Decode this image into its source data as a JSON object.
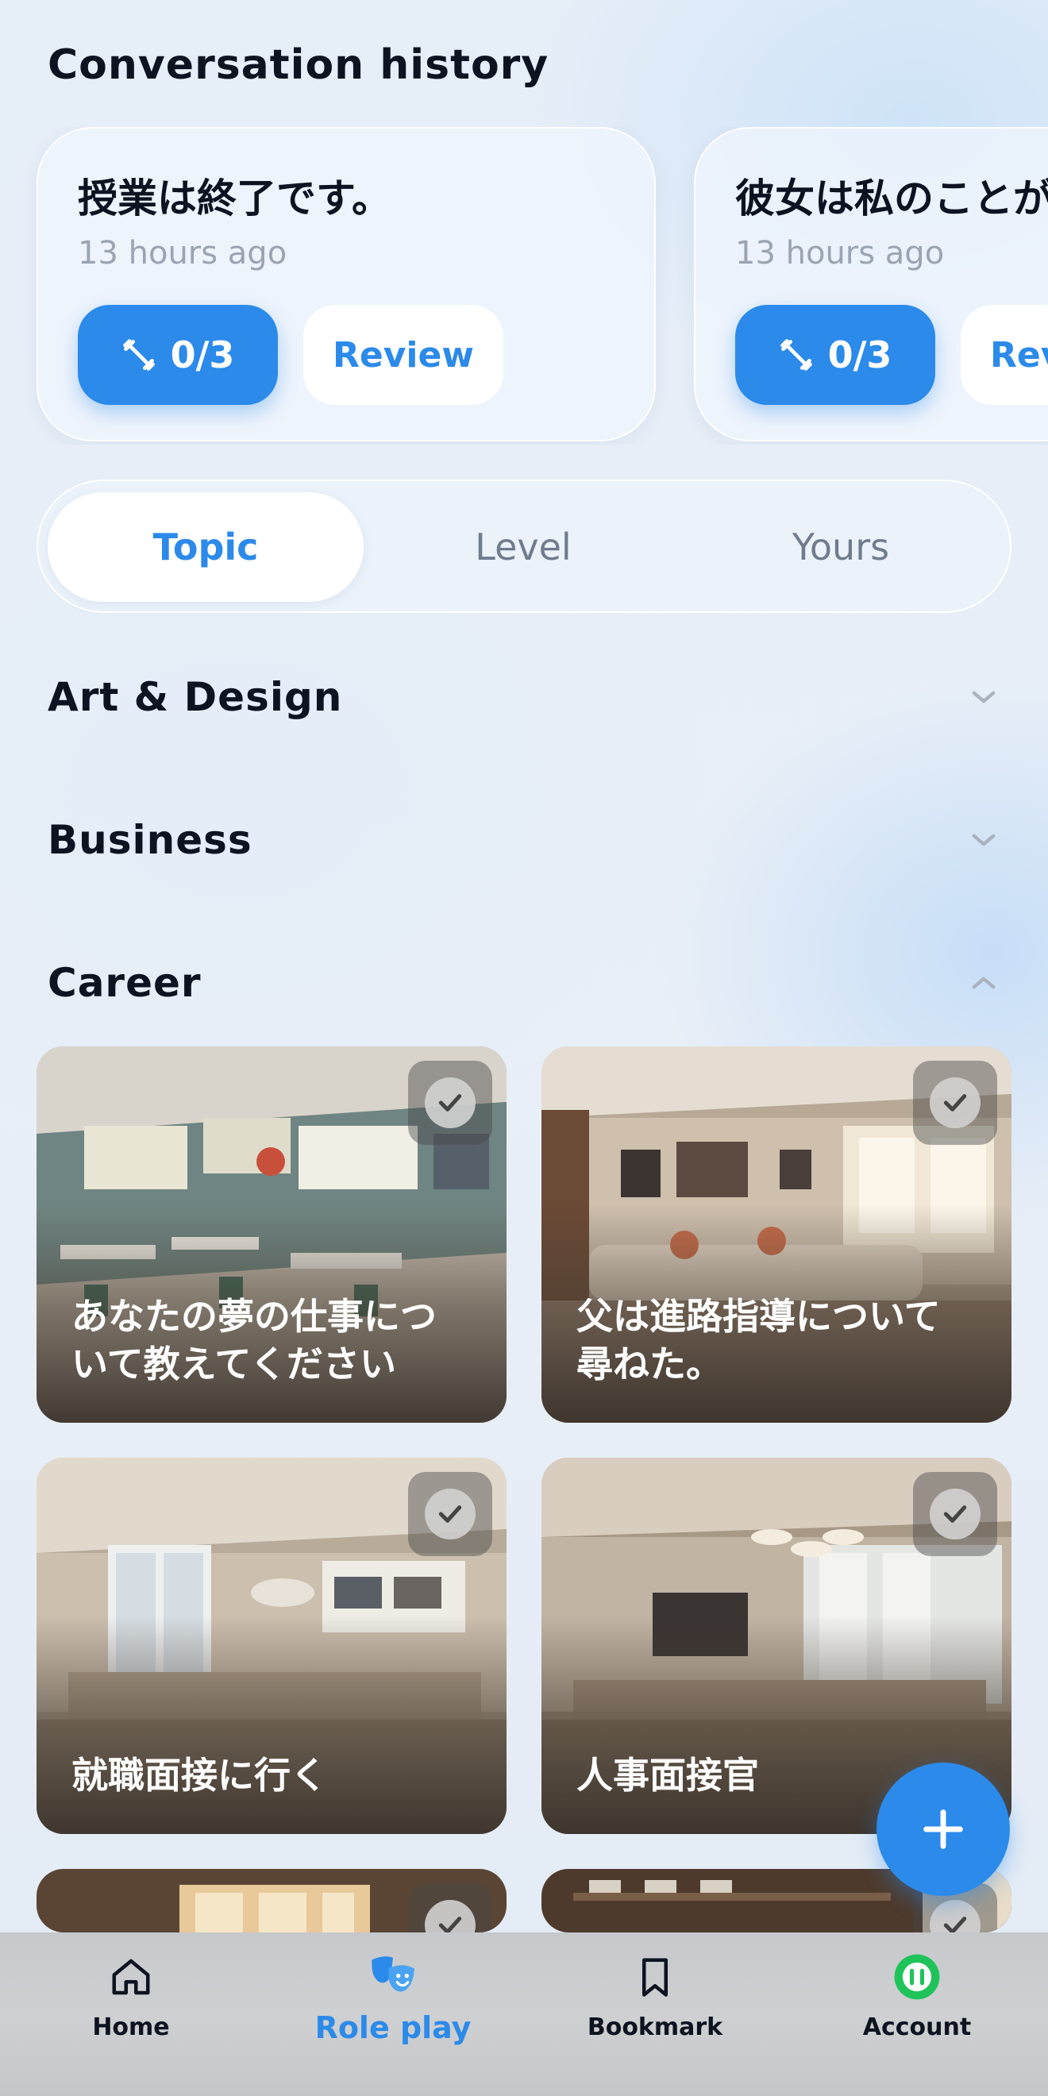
{
  "history": {
    "title": "Conversation history",
    "cards": [
      {
        "title": "授業は終了です。",
        "time": "13 hours ago",
        "progress": "0/3",
        "review_label": "Review"
      },
      {
        "title": "彼女は私のことが",
        "time": "13 hours ago",
        "progress": "0/3",
        "review_label": "Review"
      }
    ]
  },
  "tabs": {
    "items": [
      "Topic",
      "Level",
      "Yours"
    ],
    "active": "Topic"
  },
  "categories": [
    {
      "label": "Art & Design",
      "expanded": false
    },
    {
      "label": "Business",
      "expanded": false
    },
    {
      "label": "Career",
      "expanded": true
    }
  ],
  "career_cards": [
    {
      "text": "あなたの夢の仕事について教えてください",
      "completed": true,
      "scene": "classroom"
    },
    {
      "text": "父は進路指導について尋ねた。",
      "completed": true,
      "scene": "living-room"
    },
    {
      "text": "就職面接に行く",
      "completed": true,
      "scene": "meeting-room"
    },
    {
      "text": "人事面接官",
      "completed": true,
      "scene": "office"
    },
    {
      "text": "",
      "completed": true,
      "scene": "hall"
    },
    {
      "text": "",
      "completed": true,
      "scene": "kitchen"
    }
  ],
  "fab": {
    "icon": "plus-icon"
  },
  "nav": {
    "items": [
      {
        "label": "Home",
        "icon": "home-icon"
      },
      {
        "label": "Role play",
        "icon": "theater-masks-icon"
      },
      {
        "label": "Bookmark",
        "icon": "bookmark-icon"
      },
      {
        "label": "Account",
        "icon": "account-icon"
      }
    ],
    "active": "Role play"
  },
  "colors": {
    "accent": "#2b8aea",
    "text": "#0d1320",
    "muted": "#9aa4b2",
    "account_green": "#1fc35a"
  }
}
